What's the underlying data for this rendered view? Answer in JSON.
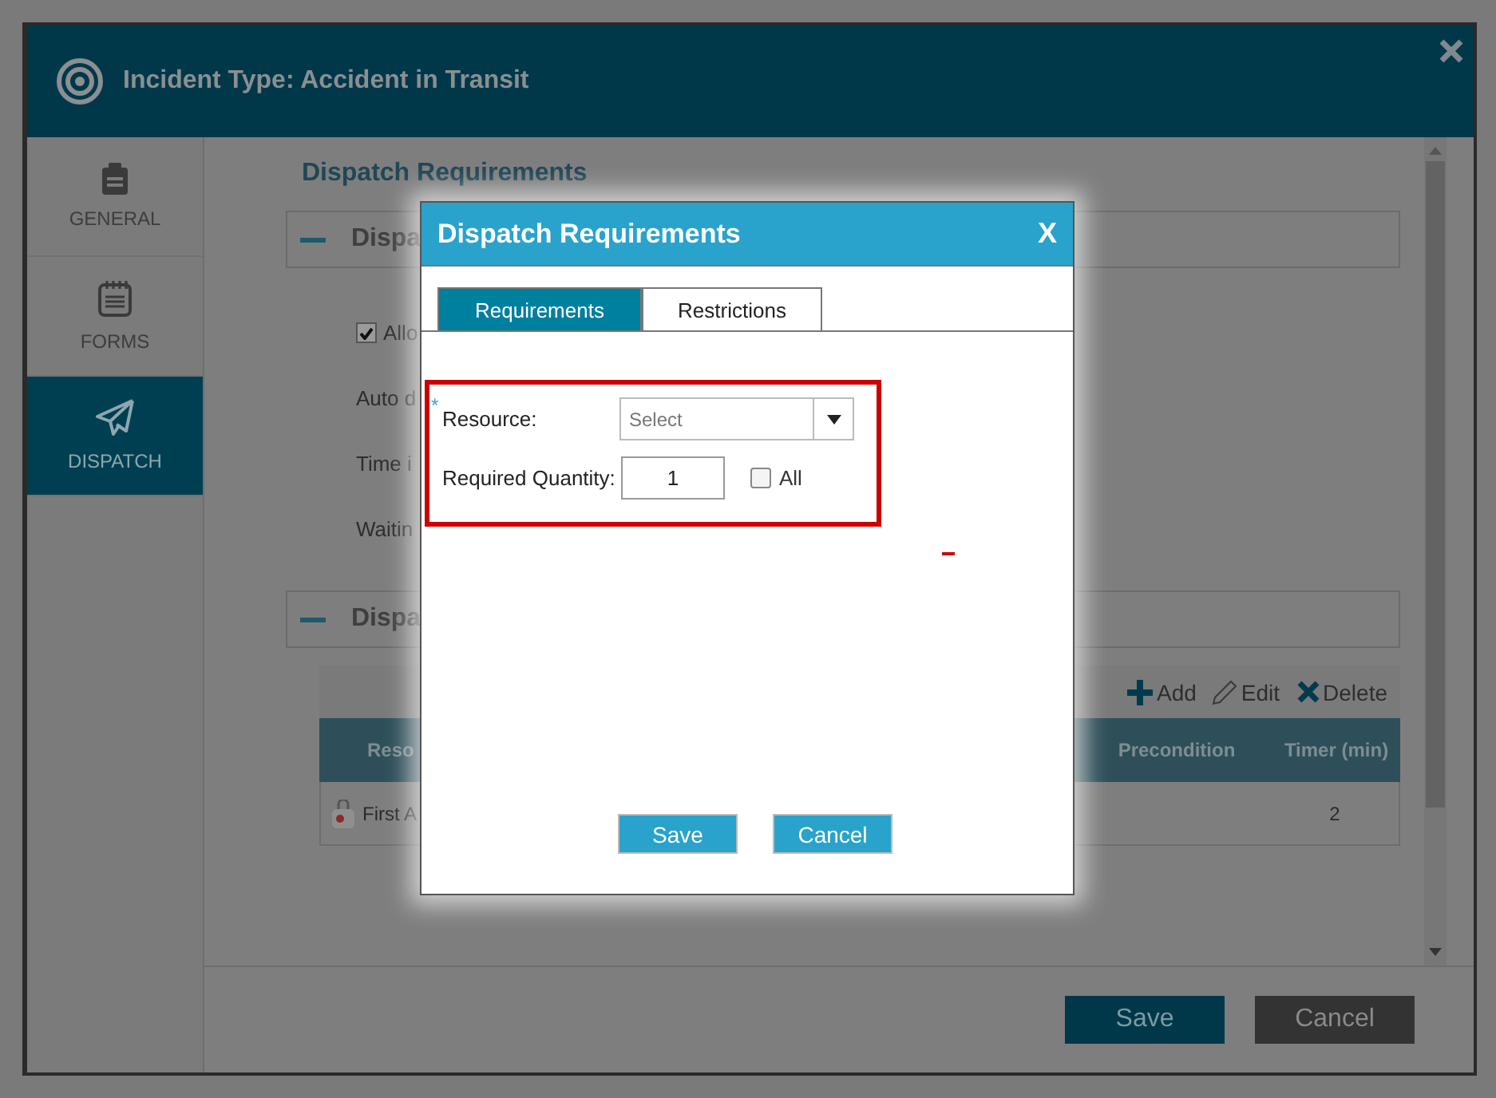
{
  "window": {
    "title": "Incident Type: Accident in Transit"
  },
  "sidebar": {
    "items": [
      {
        "label": "GENERAL",
        "kind": "clipboard",
        "selected": false
      },
      {
        "label": "FORMS",
        "kind": "notepad",
        "selected": false
      },
      {
        "label": "DISPATCH",
        "kind": "plane",
        "selected": true
      }
    ]
  },
  "content": {
    "title": "Dispatch Requirements",
    "section_1": {
      "title": "Dispa",
      "expanded": true,
      "checkbox": {
        "label": "Allo",
        "checked": true
      },
      "fields": [
        "Auto d",
        "Time i",
        "Waitin"
      ]
    },
    "section_2": {
      "title": "Dispa",
      "expanded": true,
      "toolbar": [
        {
          "label": "Add",
          "kind": "add"
        },
        {
          "label": "Edit",
          "kind": "edit"
        },
        {
          "label": "Delete",
          "kind": "delete"
        }
      ],
      "columns": [
        "Reso",
        "Precondition",
        "Timer (min)"
      ],
      "rows": [
        {
          "resource": "First A",
          "timer": "2"
        }
      ]
    }
  },
  "footer": {
    "buttons": [
      {
        "label": "Save",
        "kind": "primary"
      },
      {
        "label": "Cancel",
        "kind": "secondary"
      }
    ]
  },
  "modal": {
    "title": "Dispatch Requirements",
    "close": "X",
    "tabs": [
      {
        "label": "Requirements",
        "selected": true
      },
      {
        "label": "Restrictions",
        "selected": false
      }
    ],
    "required_mark": "*",
    "resource": {
      "label": "Resource:",
      "placeholder": "Select"
    },
    "quantity": {
      "label": "Required Quantity:",
      "value": "1"
    },
    "all": {
      "label": "All",
      "checked": false
    },
    "buttons": [
      "Save",
      "Cancel"
    ]
  }
}
